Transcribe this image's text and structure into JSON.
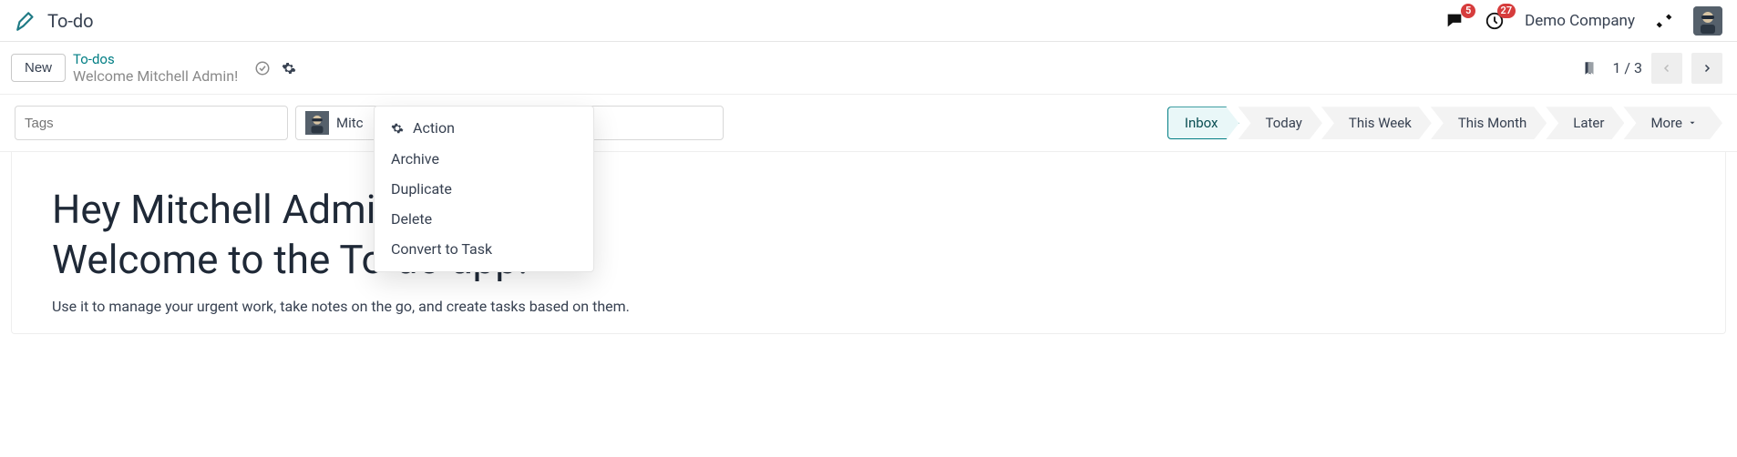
{
  "navbar": {
    "app_title": "To-do",
    "messages_badge": "5",
    "activities_badge": "27",
    "company": "Demo Company"
  },
  "control_panel": {
    "new_label": "New",
    "breadcrumb_parent": "To-dos",
    "breadcrumb_current": "Welcome Mitchell Admin!",
    "pager_text": "1 / 3"
  },
  "action_menu": {
    "title": "Action",
    "items": [
      "Archive",
      "Duplicate",
      "Delete",
      "Convert to Task"
    ]
  },
  "form": {
    "tags_placeholder": "Tags",
    "assignee_prefix": "Mitc",
    "stages": [
      "Inbox",
      "Today",
      "This Week",
      "This Month",
      "Later"
    ],
    "more_label": "More",
    "active_stage_index": 0
  },
  "content": {
    "heading_line1": "Hey Mitchell Admin!",
    "heading_line2": "Welcome to the To-do app!",
    "paragraph": "Use it to manage your urgent work, take notes on the go, and create tasks based on them."
  }
}
